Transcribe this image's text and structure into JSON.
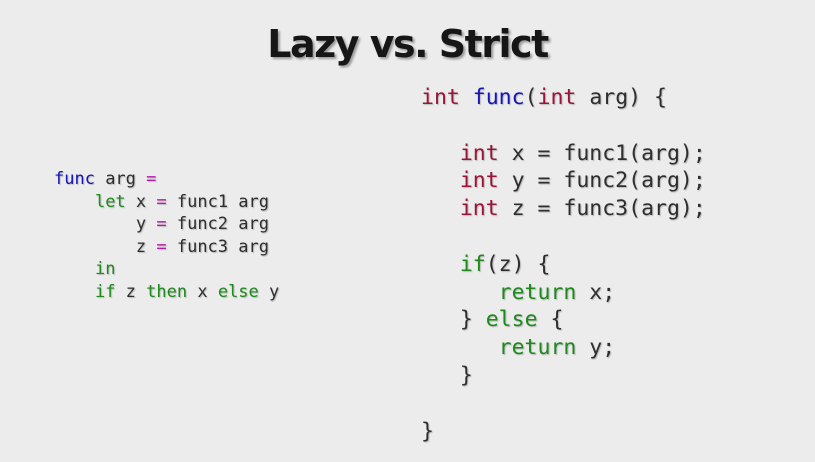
{
  "slide": {
    "title": "Lazy vs. Strict"
  },
  "colors": {
    "background": "#ececec",
    "plain": "#2e2e2e",
    "keyword": "#1e8a1e",
    "definition": "#1616b6",
    "operator": "#b01ea8",
    "type": "#9a1638"
  },
  "haskell_code": {
    "lines": [
      [
        {
          "t": "func",
          "c": "definition"
        },
        {
          "t": " arg ",
          "c": "plain"
        },
        {
          "t": "=",
          "c": "operator"
        }
      ],
      [
        {
          "t": "    ",
          "c": "plain"
        },
        {
          "t": "let",
          "c": "keyword"
        },
        {
          "t": " x ",
          "c": "plain"
        },
        {
          "t": "=",
          "c": "operator"
        },
        {
          "t": " func1 arg",
          "c": "plain"
        }
      ],
      [
        {
          "t": "        y ",
          "c": "plain"
        },
        {
          "t": "=",
          "c": "operator"
        },
        {
          "t": " func2 arg",
          "c": "plain"
        }
      ],
      [
        {
          "t": "        z ",
          "c": "plain"
        },
        {
          "t": "=",
          "c": "operator"
        },
        {
          "t": " func3 arg",
          "c": "plain"
        }
      ],
      [
        {
          "t": "    ",
          "c": "plain"
        },
        {
          "t": "in",
          "c": "keyword"
        }
      ],
      [
        {
          "t": "    ",
          "c": "plain"
        },
        {
          "t": "if",
          "c": "keyword"
        },
        {
          "t": " z ",
          "c": "plain"
        },
        {
          "t": "then",
          "c": "keyword"
        },
        {
          "t": " x ",
          "c": "plain"
        },
        {
          "t": "else",
          "c": "keyword"
        },
        {
          "t": " y",
          "c": "plain"
        }
      ]
    ]
  },
  "c_code": {
    "lines": [
      [
        {
          "t": "int",
          "c": "type"
        },
        {
          "t": " ",
          "c": "plain"
        },
        {
          "t": "func",
          "c": "definition"
        },
        {
          "t": "(",
          "c": "plain"
        },
        {
          "t": "int",
          "c": "type"
        },
        {
          "t": " arg) {",
          "c": "plain"
        }
      ],
      [
        {
          "t": "",
          "c": "plain"
        }
      ],
      [
        {
          "t": "   ",
          "c": "plain"
        },
        {
          "t": "int",
          "c": "type"
        },
        {
          "t": " x = func1(arg);",
          "c": "plain"
        }
      ],
      [
        {
          "t": "   ",
          "c": "plain"
        },
        {
          "t": "int",
          "c": "type"
        },
        {
          "t": " y = func2(arg);",
          "c": "plain"
        }
      ],
      [
        {
          "t": "   ",
          "c": "plain"
        },
        {
          "t": "int",
          "c": "type"
        },
        {
          "t": " z = func3(arg);",
          "c": "plain"
        }
      ],
      [
        {
          "t": "",
          "c": "plain"
        }
      ],
      [
        {
          "t": "   ",
          "c": "plain"
        },
        {
          "t": "if",
          "c": "keyword"
        },
        {
          "t": "(z) {",
          "c": "plain"
        }
      ],
      [
        {
          "t": "      ",
          "c": "plain"
        },
        {
          "t": "return",
          "c": "keyword"
        },
        {
          "t": " x;",
          "c": "plain"
        }
      ],
      [
        {
          "t": "   } ",
          "c": "plain"
        },
        {
          "t": "else",
          "c": "keyword"
        },
        {
          "t": " {",
          "c": "plain"
        }
      ],
      [
        {
          "t": "      ",
          "c": "plain"
        },
        {
          "t": "return",
          "c": "keyword"
        },
        {
          "t": " y;",
          "c": "plain"
        }
      ],
      [
        {
          "t": "   }",
          "c": "plain"
        }
      ],
      [
        {
          "t": "",
          "c": "plain"
        }
      ],
      [
        {
          "t": "}",
          "c": "plain"
        }
      ]
    ]
  }
}
